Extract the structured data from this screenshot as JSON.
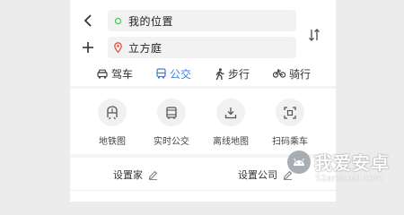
{
  "route": {
    "from_label": "我的位置",
    "to_label": "立方庭"
  },
  "modes": [
    {
      "label": "驾车",
      "icon": "car-icon"
    },
    {
      "label": "公交",
      "icon": "bus-icon",
      "active": true
    },
    {
      "label": "步行",
      "icon": "walk-icon"
    },
    {
      "label": "骑行",
      "icon": "bike-icon"
    }
  ],
  "quick_actions": [
    {
      "label": "地铁图",
      "icon": "subway-icon"
    },
    {
      "label": "实时公交",
      "icon": "realtime-bus-icon"
    },
    {
      "label": "离线地图",
      "icon": "download-icon"
    },
    {
      "label": "扫码乘车",
      "icon": "scan-icon"
    }
  ],
  "shortcuts": {
    "home_label": "设置家",
    "work_label": "设置公司"
  },
  "watermark": {
    "title": "我爱安卓",
    "url": "52android.com"
  },
  "colors": {
    "accent": "#3f7ee8",
    "origin_dot": "#39b54a",
    "destination_pin": "#e2553b"
  }
}
